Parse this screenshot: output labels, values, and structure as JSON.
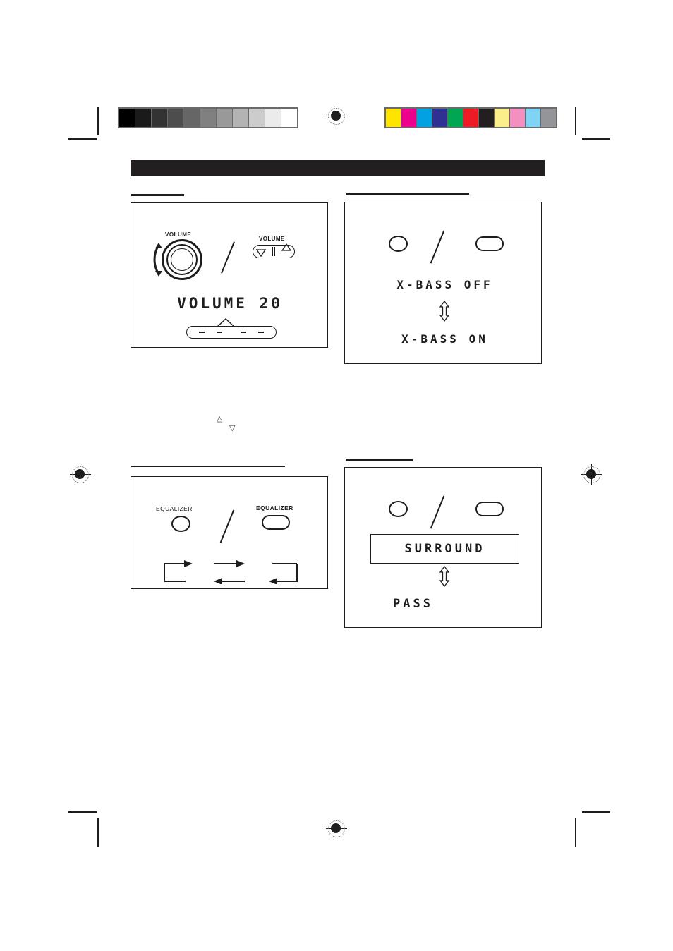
{
  "page": {
    "kind": "printer-proof-page",
    "background_color": "#ffffff",
    "header_bar_color": "#231f20"
  },
  "calibration": {
    "grayscale_label": "grayscale-step-wedge",
    "grayscale_steps": [
      "#000000",
      "#1a1a1a",
      "#333333",
      "#4d4d4d",
      "#666666",
      "#808080",
      "#999999",
      "#b3b3b3",
      "#cccccc",
      "#ebebeb",
      "#ffffff"
    ],
    "color_label": "color-control-patches",
    "color_steps": [
      "#ffe400",
      "#ec008c",
      "#00a3e0",
      "#2e3192",
      "#00a651",
      "#ed1c24",
      "#231f20",
      "#fbef8c",
      "#f490c0",
      "#7fd4f5",
      "#939598"
    ],
    "strip_border_color": "#6a6a6a"
  },
  "registration": {
    "name": "registration-target"
  },
  "panels": [
    {
      "id": "volume-panel",
      "rule_width": 75,
      "knob_label": "VOLUME",
      "rocker_label": "VOLUME",
      "rocker_down_icon": "triangle-down-icon",
      "rocker_up_icon": "triangle-up-icon",
      "rotate_icon": "rotate-arrow-icon",
      "separator": "/",
      "display_text": "VOLUME 20",
      "dash_count": 4
    },
    {
      "id": "xbass-panel",
      "rule_width": 175,
      "knob_icon": "round-button-icon",
      "button_icon": "oval-button-icon",
      "separator": "/",
      "display_top_text": "X-BASS OFF",
      "display_bottom_text": "X-BASS ON",
      "toggle_icon": "up-down-arrow-icon"
    },
    {
      "id": "equalizer-panel",
      "rule_width": 218,
      "left_label": "EQUALIZER",
      "right_label": "EQUALIZER",
      "separator": "/",
      "cycle_icon": "cycle-arrows-icon"
    },
    {
      "id": "surround-panel",
      "rule_width": 95,
      "knob_icon": "round-button-icon",
      "button_icon": "oval-button-icon",
      "separator": "/",
      "display_top_text": "SURROUND",
      "display_bottom_text": "PASS",
      "toggle_icon": "up-down-arrow-icon"
    }
  ],
  "orphan_glyphs": {
    "up": "△",
    "down": "▽"
  }
}
